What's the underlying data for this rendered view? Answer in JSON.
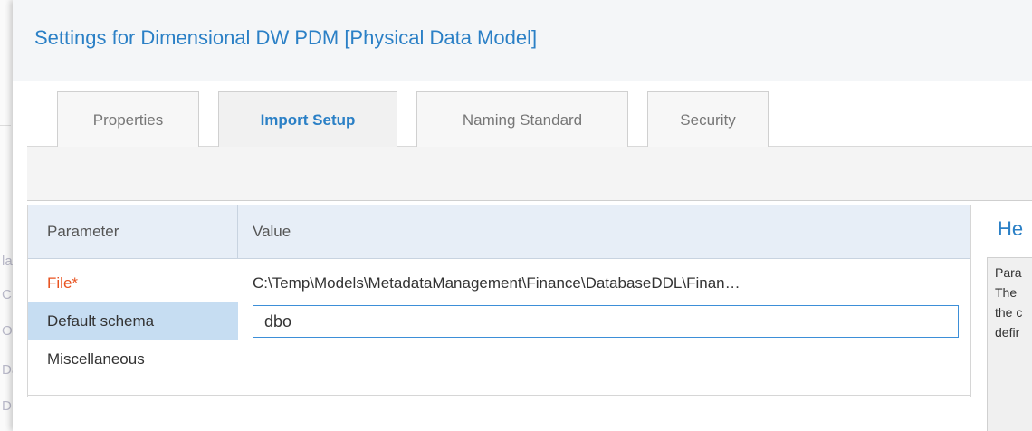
{
  "background": {
    "fragments": [
      "la",
      "C",
      "O",
      "Da",
      "D"
    ]
  },
  "dialog": {
    "title": "Settings for Dimensional DW PDM [Physical Data Model]"
  },
  "tabs": [
    {
      "label": "Properties",
      "active": false
    },
    {
      "label": "Import Setup",
      "active": true
    },
    {
      "label": "Naming Standard",
      "active": false
    },
    {
      "label": "Security",
      "active": false
    }
  ],
  "grid": {
    "columns": [
      "Parameter",
      "Value"
    ],
    "rows": [
      {
        "parameter": "File*",
        "value": "C:\\Temp\\Models\\MetadataManagement\\Finance\\DatabaseDDL\\Finan…",
        "required": true
      },
      {
        "parameter": "Default schema",
        "value": "dbo",
        "editing": true
      },
      {
        "parameter": "Miscellaneous",
        "value": ""
      }
    ]
  },
  "help": {
    "title": "He",
    "lines": [
      "Para",
      "The",
      "the c",
      "defir"
    ]
  },
  "colors": {
    "accent": "#2b80c6",
    "required": "#e8521f",
    "selected_row": "#c6ddf2",
    "header_bg": "#e7eef7"
  }
}
